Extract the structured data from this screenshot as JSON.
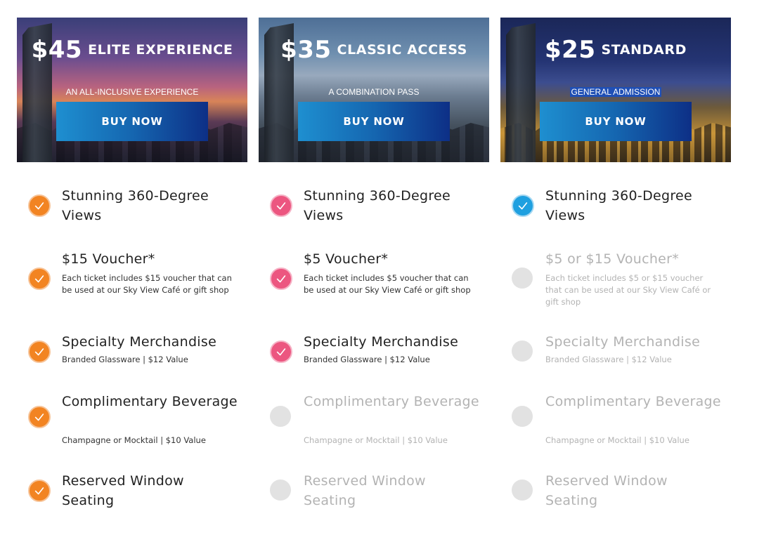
{
  "tiers": [
    {
      "price": "$45",
      "name": "ELITE EXPERIENCE",
      "subtitle": "AN ALL-INCLUSIVE EXPERIENCE",
      "buy_label": "BUY NOW",
      "accent": "#f28422",
      "features": [
        {
          "title": "Stunning 360-Degree Views",
          "desc": "",
          "included": true,
          "icon": "check-icon"
        },
        {
          "title": "$15 Voucher*",
          "desc": "Each ticket includes $15 voucher that can be used at our Sky View Café or gift shop",
          "included": true,
          "icon": "check-icon"
        },
        {
          "title": "Specialty Merchandise",
          "desc": "Branded Glassware | $12 Value",
          "included": true,
          "icon": "check-icon"
        },
        {
          "title": "Complimentary Beverage",
          "desc": "Champagne or Mocktail | $10 Value",
          "included": true,
          "icon": "check-icon"
        },
        {
          "title": "Reserved Window Seating",
          "desc": "",
          "included": true,
          "icon": "check-icon"
        }
      ]
    },
    {
      "price": "$35",
      "name": "CLASSIC ACCESS",
      "subtitle": "A COMBINATION PASS",
      "buy_label": "BUY NOW",
      "accent": "#ec5680",
      "features": [
        {
          "title": "Stunning 360-Degree Views",
          "desc": "",
          "included": true,
          "icon": "check-icon"
        },
        {
          "title": "$5 Voucher*",
          "desc": "Each ticket includes $5 voucher that can be used at our Sky View Café or gift shop",
          "included": true,
          "icon": "check-icon"
        },
        {
          "title": "Specialty Merchandise",
          "desc": "Branded Glassware | $12 Value",
          "included": true,
          "icon": "check-icon"
        },
        {
          "title": "Complimentary Beverage",
          "desc": "Champagne or Mocktail | $10 Value",
          "included": false,
          "icon": "empty-circle-icon"
        },
        {
          "title": "Reserved Window Seating",
          "desc": "",
          "included": false,
          "icon": "empty-circle-icon"
        }
      ]
    },
    {
      "price": "$25",
      "name": "STANDARD",
      "subtitle": "GENERAL ADMISSION",
      "buy_label": "BUY NOW",
      "accent": "#1fa0e0",
      "features": [
        {
          "title": "Stunning 360-Degree Views",
          "desc": "",
          "included": true,
          "icon": "check-icon"
        },
        {
          "title": "$5 or $15 Voucher*",
          "desc": "Each ticket includes $5 or $15 voucher that can be used at our Sky View Café or gift shop",
          "included": false,
          "icon": "empty-circle-icon"
        },
        {
          "title": "Specialty Merchandise",
          "desc": "Branded Glassware | $12 Value",
          "included": false,
          "icon": "empty-circle-icon"
        },
        {
          "title": "Complimentary Beverage",
          "desc": "Champagne or Mocktail | $10 Value",
          "included": false,
          "icon": "empty-circle-icon"
        },
        {
          "title": "Reserved Window Seating",
          "desc": "",
          "included": false,
          "icon": "empty-circle-icon"
        }
      ]
    }
  ]
}
